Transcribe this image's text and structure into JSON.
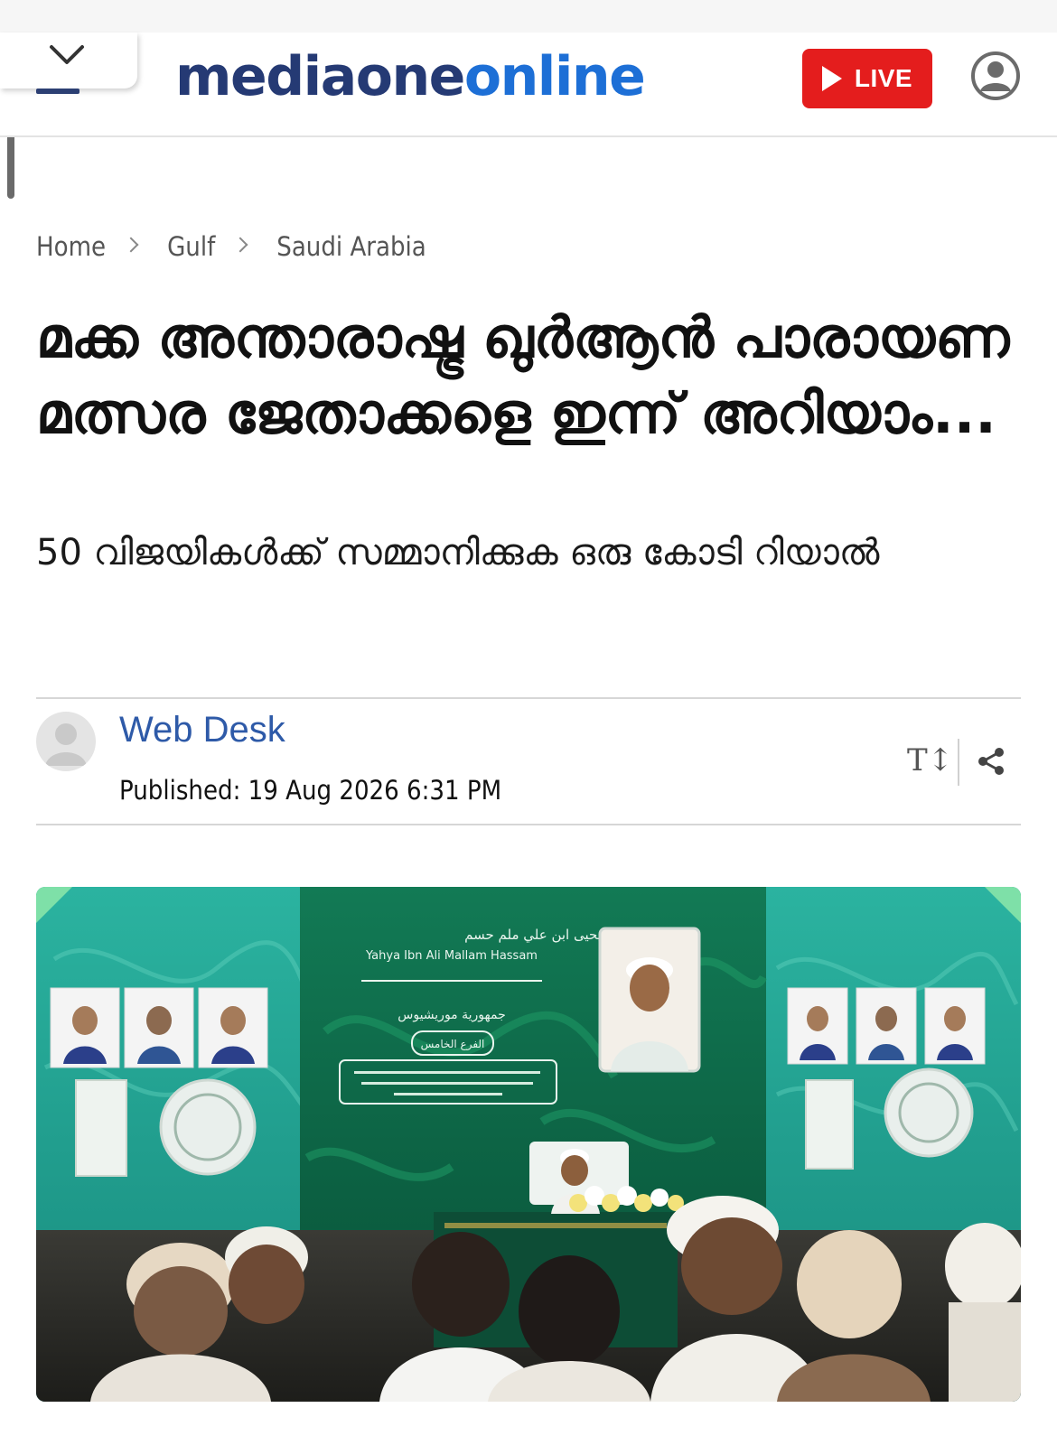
{
  "header": {
    "logo_part1": "mediaone",
    "logo_part2": "online",
    "live_label": "LIVE",
    "icons": {
      "collapse": "chevron-down-icon",
      "live": "play-icon",
      "account": "user-account-icon"
    }
  },
  "breadcrumb": {
    "items": [
      "Home",
      "Gulf",
      "Saudi Arabia"
    ]
  },
  "article": {
    "headline": "മക്ക അന്താരാഷ്ട്ര ഖുർആൻ പാരായണ മത്സര ജേതാക്കളെ ഇന്ന് അറിയാം...",
    "subheadline": "50 വിജയികൾക്ക് സമ്മാനിക്കുക ഒരു കോടി റിയാൽ",
    "author": "Web Desk",
    "published": "Published: 19 Aug 2026 6:31 PM",
    "tools": {
      "font_size_label": "T↕",
      "share_icon": "share-icon"
    }
  },
  "photo": {
    "screen_title_arabic": "يحيى ابن علي ملم حسم",
    "screen_title_english": "Yahya Ibn Ali Mallam Hassam",
    "screen_country": "جمهورية موريشيوس",
    "screen_branch": "الفرع الخامس"
  },
  "colors": {
    "logo_dark": "#253a74",
    "logo_blue": "#1d6fd6",
    "live_red": "#e41d1d",
    "author_blue": "#2e5aa8",
    "backdrop_teal": "#1f9c8c",
    "screen_green": "#0f6b4a"
  }
}
